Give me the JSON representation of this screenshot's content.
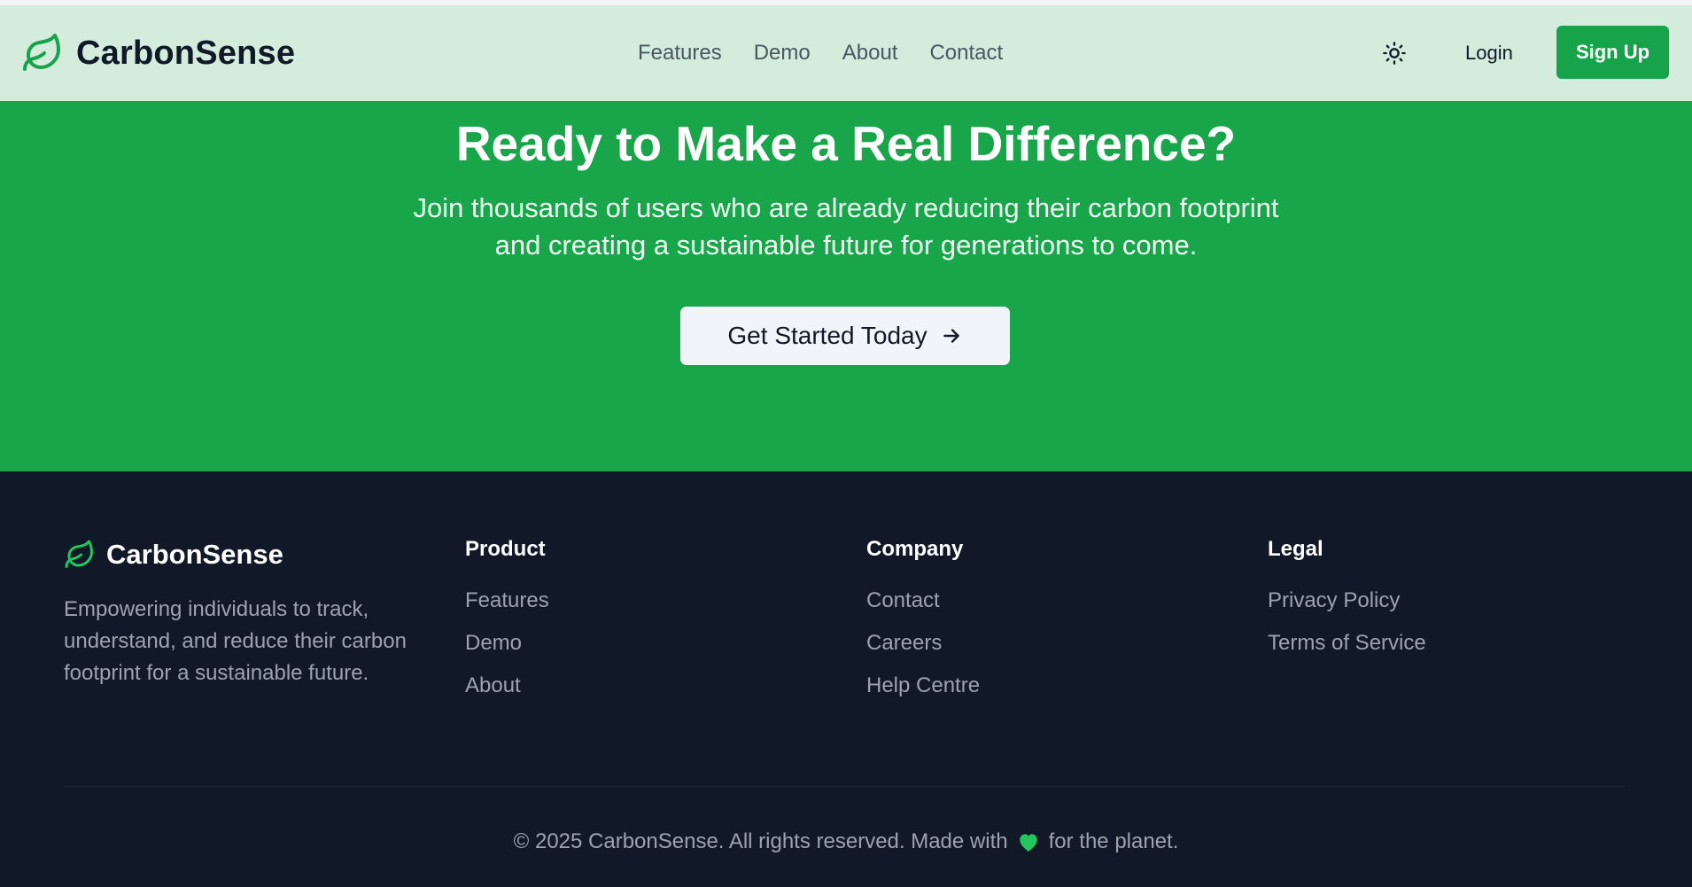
{
  "brand": {
    "name": "CarbonSense",
    "logo_icon": "leaf-icon",
    "accent": "#16a34a"
  },
  "nav": {
    "links": [
      "Features",
      "Demo",
      "About",
      "Contact"
    ],
    "theme_icon": "sun-icon",
    "login_label": "Login",
    "signup_label": "Sign Up"
  },
  "hero": {
    "title": "Ready to Make a Real Difference?",
    "subtitle": "Join thousands of users who are already reducing their carbon footprint and creating a sustainable future for generations to come.",
    "cta_label": "Get Started Today",
    "cta_icon": "arrow-right-icon",
    "background": "#19a54a"
  },
  "footer": {
    "brand_name": "CarbonSense",
    "description": "Empowering individuals to track, understand, and reduce their carbon footprint for a sustainable future.",
    "columns": [
      {
        "title": "Product",
        "links": [
          "Features",
          "Demo",
          "About"
        ]
      },
      {
        "title": "Company",
        "links": [
          "Contact",
          "Careers",
          "Help Centre"
        ]
      },
      {
        "title": "Legal",
        "links": [
          "Privacy Policy",
          "Terms of Service"
        ]
      }
    ],
    "copyright_prefix": "© 2025 CarbonSense. All rights reserved. Made with",
    "copyright_suffix": "for the planet.",
    "heart_icon": "green-heart-icon",
    "background": "#111827"
  }
}
